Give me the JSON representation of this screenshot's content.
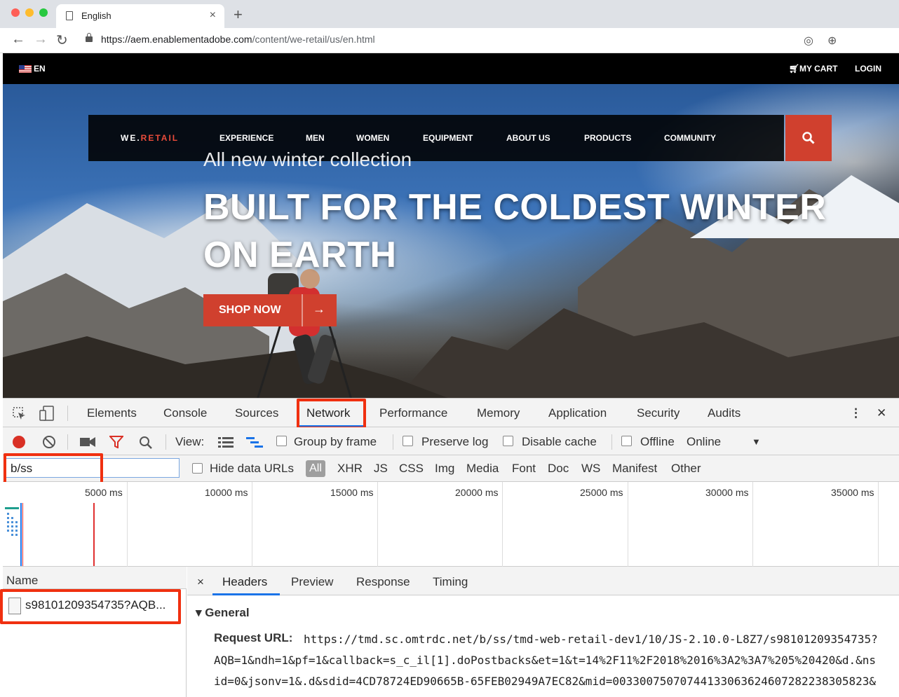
{
  "browser": {
    "tab_title": "English",
    "tab_close": "×",
    "new_tab": "+",
    "url_host": "https://aem.enablementadobe.com",
    "url_path": "/content/we-retail/us/en.html",
    "back": "←",
    "forward": "→",
    "reload": "↻"
  },
  "site": {
    "lang": "EN",
    "my_cart": "MY CART",
    "login": "LOGIN",
    "brand_prefix": "WE.",
    "brand_suffix": "RETAIL",
    "nav": [
      "EXPERIENCE",
      "MEN",
      "WOMEN",
      "EQUIPMENT",
      "ABOUT US",
      "PRODUCTS",
      "COMMUNITY"
    ],
    "subtitle": "All new winter collection",
    "headline": "BUILT FOR THE COLDEST WINTER ON EARTH",
    "shop_now": "SHOP NOW",
    "shop_arrow": "→"
  },
  "devtools": {
    "tabs": [
      "Elements",
      "Console",
      "Sources",
      "Network",
      "Performance",
      "Memory",
      "Application",
      "Security",
      "Audits"
    ],
    "active_tab": "Network",
    "kebab": "⋮",
    "close": "✕",
    "view_label": "View:",
    "group_by_frame": "Group by frame",
    "preserve_log": "Preserve log",
    "disable_cache": "Disable cache",
    "offline": "Offline",
    "throttle": "Online",
    "throttle_arrow": "▼",
    "filter_value": "b/ss",
    "hide_data_urls": "Hide data URLs",
    "types": [
      "All",
      "XHR",
      "JS",
      "CSS",
      "Img",
      "Media",
      "Font",
      "Doc",
      "WS",
      "Manifest",
      "Other"
    ],
    "timeline_labels": [
      "5000 ms",
      "10000 ms",
      "15000 ms",
      "20000 ms",
      "25000 ms",
      "30000 ms",
      "35000 ms"
    ],
    "name_header": "Name",
    "request_name": "s98101209354735?AQB...",
    "detail_close": "×",
    "detail_tabs": [
      "Headers",
      "Preview",
      "Response",
      "Timing"
    ],
    "general": "▾ General",
    "request_url_label": "Request URL:",
    "request_url_lines": [
      "https://tmd.sc.omtrdc.net/b/ss/tmd-web-retail-dev1/10/JS-2.10.0-L8Z7/s98101209354735?",
      "AQB=1&ndh=1&pf=1&callback=s_c_il[1].doPostbacks&et=1&t=14%2F11%2F2018%2016%3A2%3A7%205%20420&d.&ns",
      "id=0&jsonv=1&.d&sdid=4CD78724ED90665B-65FEB02949A7EC82&mid=00330075070744133063624607282238305823&"
    ]
  },
  "colors": {
    "accent_red": "#d0402e",
    "highlight_red": "#f03010",
    "devtools_blue": "#1a73e8"
  }
}
